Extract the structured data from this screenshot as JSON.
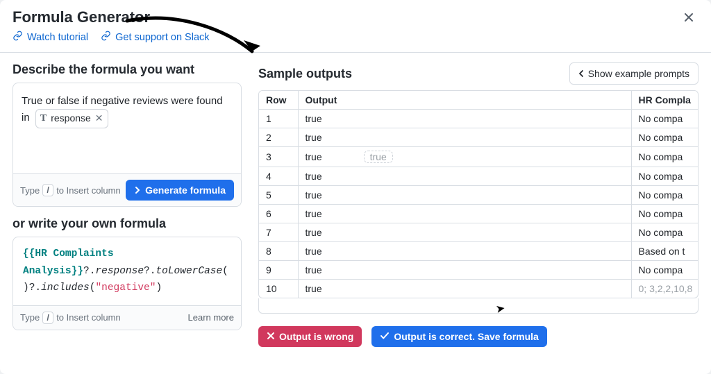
{
  "header": {
    "title": "Formula Generator",
    "watch_tutorial": "Watch tutorial",
    "get_support": "Get support on Slack"
  },
  "left": {
    "describe_title": "Describe the formula you want",
    "description_prefix": "True or false if negative reviews were found in",
    "token_label": "response",
    "hint_type": "Type",
    "hint_key": "/",
    "hint_suffix": "to Insert column",
    "generate_label": "Generate formula",
    "own_title": "or write your own formula",
    "code_var": "{{HR Complaints Analysis}}",
    "code_after_var": "?.",
    "code_prop1": "response",
    "code_q": "?.",
    "code_prop2": "toLowerCase",
    "code_paren_open": "(",
    "code_paren_close": ")",
    "code_chain": "?.",
    "code_prop3": "includes",
    "code_arg_open": "(",
    "code_string": "\"negative\"",
    "code_arg_close": ")",
    "learn_more": "Learn more"
  },
  "right": {
    "sample_title": "Sample outputs",
    "show_examples": "Show example prompts",
    "col_row": "Row",
    "col_output": "Output",
    "col_hr": "HR Compla",
    "ghost_value": "true",
    "rows": [
      {
        "row": "1",
        "output": "true",
        "hr": "No compa"
      },
      {
        "row": "2",
        "output": "true",
        "hr": "No compa"
      },
      {
        "row": "3",
        "output": "true",
        "hr": "No compa"
      },
      {
        "row": "4",
        "output": "true",
        "hr": "No compa"
      },
      {
        "row": "5",
        "output": "true",
        "hr": "No compa"
      },
      {
        "row": "6",
        "output": "true",
        "hr": "No compa"
      },
      {
        "row": "7",
        "output": "true",
        "hr": "No compa"
      },
      {
        "row": "8",
        "output": "true",
        "hr": "Based on t"
      },
      {
        "row": "9",
        "output": "true",
        "hr": "No compa"
      },
      {
        "row": "10",
        "output": "true",
        "hr": ""
      }
    ],
    "row10_hr_faded": "0; 3,2,2,10,8",
    "wrong_label": "Output is wrong",
    "correct_label": "Output is correct. Save formula"
  }
}
